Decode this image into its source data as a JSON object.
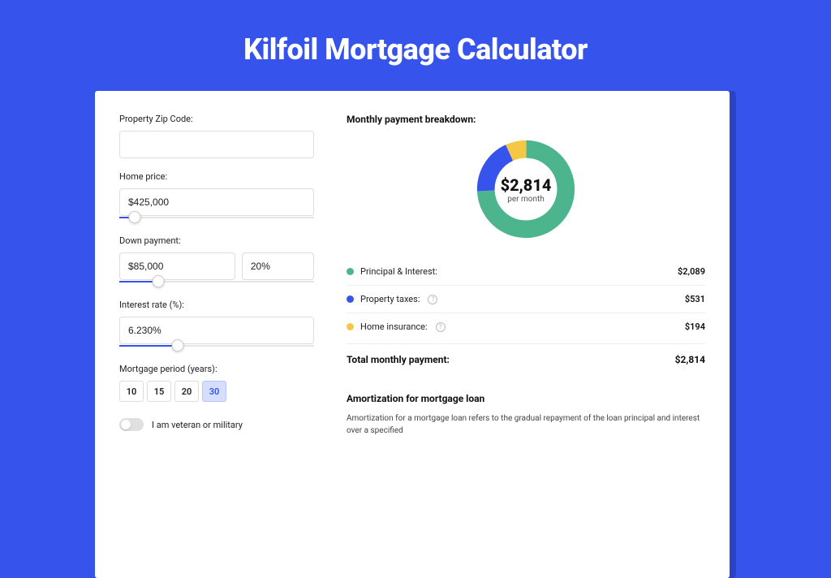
{
  "title": "Kilfoil Mortgage Calculator",
  "form": {
    "zip_label": "Property Zip Code:",
    "zip_value": "",
    "home_price_label": "Home price:",
    "home_price_value": "$425,000",
    "home_price_slider_pct": 8,
    "down_payment_label": "Down payment:",
    "down_payment_value": "$85,000",
    "down_payment_pct": "20%",
    "down_payment_slider_pct": 20,
    "interest_label": "Interest rate (%):",
    "interest_value": "6.230%",
    "interest_slider_pct": 30,
    "period_label": "Mortgage period (years):",
    "period_options": [
      "10",
      "15",
      "20",
      "30"
    ],
    "period_selected": "30",
    "veteran_label": "I am veteran or military",
    "veteran_on": false
  },
  "breakdown": {
    "title": "Monthly payment breakdown:",
    "center_amount": "$2,814",
    "center_sub": "per month",
    "items": [
      {
        "label": "Principal & Interest:",
        "value": "$2,089",
        "color": "#4db58e",
        "info": false
      },
      {
        "label": "Property taxes:",
        "value": "$531",
        "color": "#3654ec",
        "info": true
      },
      {
        "label": "Home insurance:",
        "value": "$194",
        "color": "#f5c843",
        "info": true
      }
    ],
    "total_label": "Total monthly payment:",
    "total_value": "$2,814"
  },
  "chart_data": {
    "type": "pie",
    "title": "Monthly payment breakdown",
    "series": [
      {
        "name": "Principal & Interest",
        "value": 2089,
        "color": "#4db58e"
      },
      {
        "name": "Property taxes",
        "value": 531,
        "color": "#3654ec"
      },
      {
        "name": "Home insurance",
        "value": 194,
        "color": "#f5c843"
      }
    ],
    "total": 2814,
    "center_label": "$2,814 per month"
  },
  "amortization": {
    "title": "Amortization for mortgage loan",
    "body": "Amortization for a mortgage loan refers to the gradual repayment of the loan principal and interest over a specified"
  }
}
